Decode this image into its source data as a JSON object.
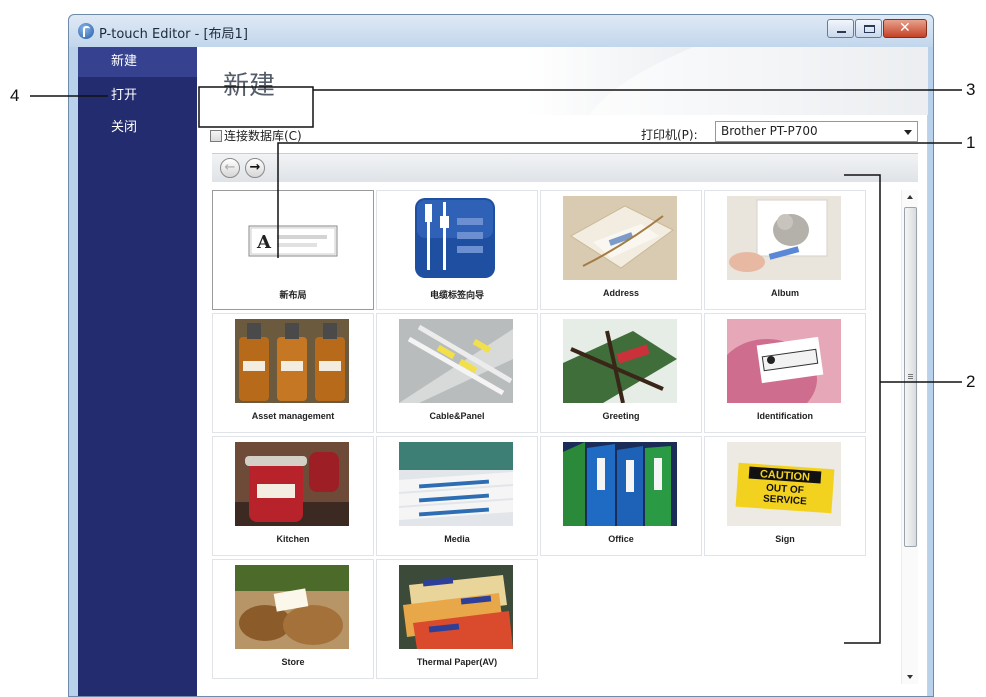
{
  "window": {
    "title": "P-touch Editor - [布局1]"
  },
  "sidebar": {
    "items": [
      {
        "label": "新建"
      },
      {
        "label": "打开"
      },
      {
        "label": "关闭"
      }
    ]
  },
  "content": {
    "page_title": "新建",
    "db_checkbox_label": "连接数据库(C)",
    "printer_label": "打印机(P):",
    "printer_value": "Brother PT-P700"
  },
  "templates": [
    {
      "label": "新布局"
    },
    {
      "label": "电缆标签向导"
    },
    {
      "label": "Address"
    },
    {
      "label": "Album"
    },
    {
      "label": "Asset management"
    },
    {
      "label": "Cable&Panel"
    },
    {
      "label": "Greeting"
    },
    {
      "label": "Identification"
    },
    {
      "label": "Kitchen"
    },
    {
      "label": "Media"
    },
    {
      "label": "Office"
    },
    {
      "label": "Sign"
    },
    {
      "label": "Store"
    },
    {
      "label": "Thermal Paper(AV)"
    }
  ],
  "callouts": {
    "c1": "1",
    "c2": "2",
    "c3": "3",
    "c4": "4"
  },
  "art_text": {
    "sign": [
      "CAUTION",
      "OUT OF",
      "SERVICE"
    ],
    "new_layout": "A"
  },
  "colors": {
    "sidebar": "#232c6e",
    "sidebar_selected": "#364290",
    "cable_wizard_tile": "#1f4fa0"
  }
}
